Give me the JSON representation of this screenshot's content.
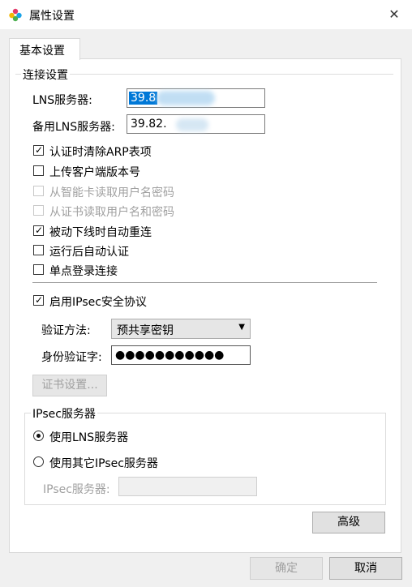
{
  "window": {
    "title": "属性设置",
    "close_glyph": "✕"
  },
  "tabs": [
    {
      "label": "基本设置"
    }
  ],
  "connection": {
    "legend": "连接设置",
    "lns_label": "LNS服务器:",
    "lns_value": "39.8",
    "backup_label": "备用LNS服务器:",
    "backup_value": "39.82.",
    "options": [
      {
        "label": "认证时清除ARP表项",
        "checked": true,
        "enabled": true
      },
      {
        "label": "上传客户端版本号",
        "checked": false,
        "enabled": true
      },
      {
        "label": "从智能卡读取用户名密码",
        "checked": false,
        "enabled": false
      },
      {
        "label": "从证书读取用户名和密码",
        "checked": false,
        "enabled": false
      },
      {
        "label": "被动下线时自动重连",
        "checked": true,
        "enabled": true
      },
      {
        "label": "运行后自动认证",
        "checked": false,
        "enabled": true
      },
      {
        "label": "单点登录连接",
        "checked": false,
        "enabled": true
      }
    ]
  },
  "ipsec": {
    "enable_label": "启用IPsec安全协议",
    "enabled": true,
    "auth_method_label": "验证方法:",
    "auth_method_value": "预共享密钥",
    "identity_label": "身份验证字:",
    "identity_value": "●●●●●●●●●●●",
    "cert_button": "证书设置...",
    "server_group": {
      "legend": "IPsec服务器",
      "radio_lns": "使用LNS服务器",
      "radio_other": "使用其它IPsec服务器",
      "selected": "lns",
      "server_label": "IPsec服务器:",
      "server_value": ""
    }
  },
  "buttons": {
    "advanced": "高级",
    "ok": "确定",
    "cancel": "取消"
  },
  "colors": {
    "selection": "#0078d7",
    "disabled_text": "#a0a0a0"
  }
}
